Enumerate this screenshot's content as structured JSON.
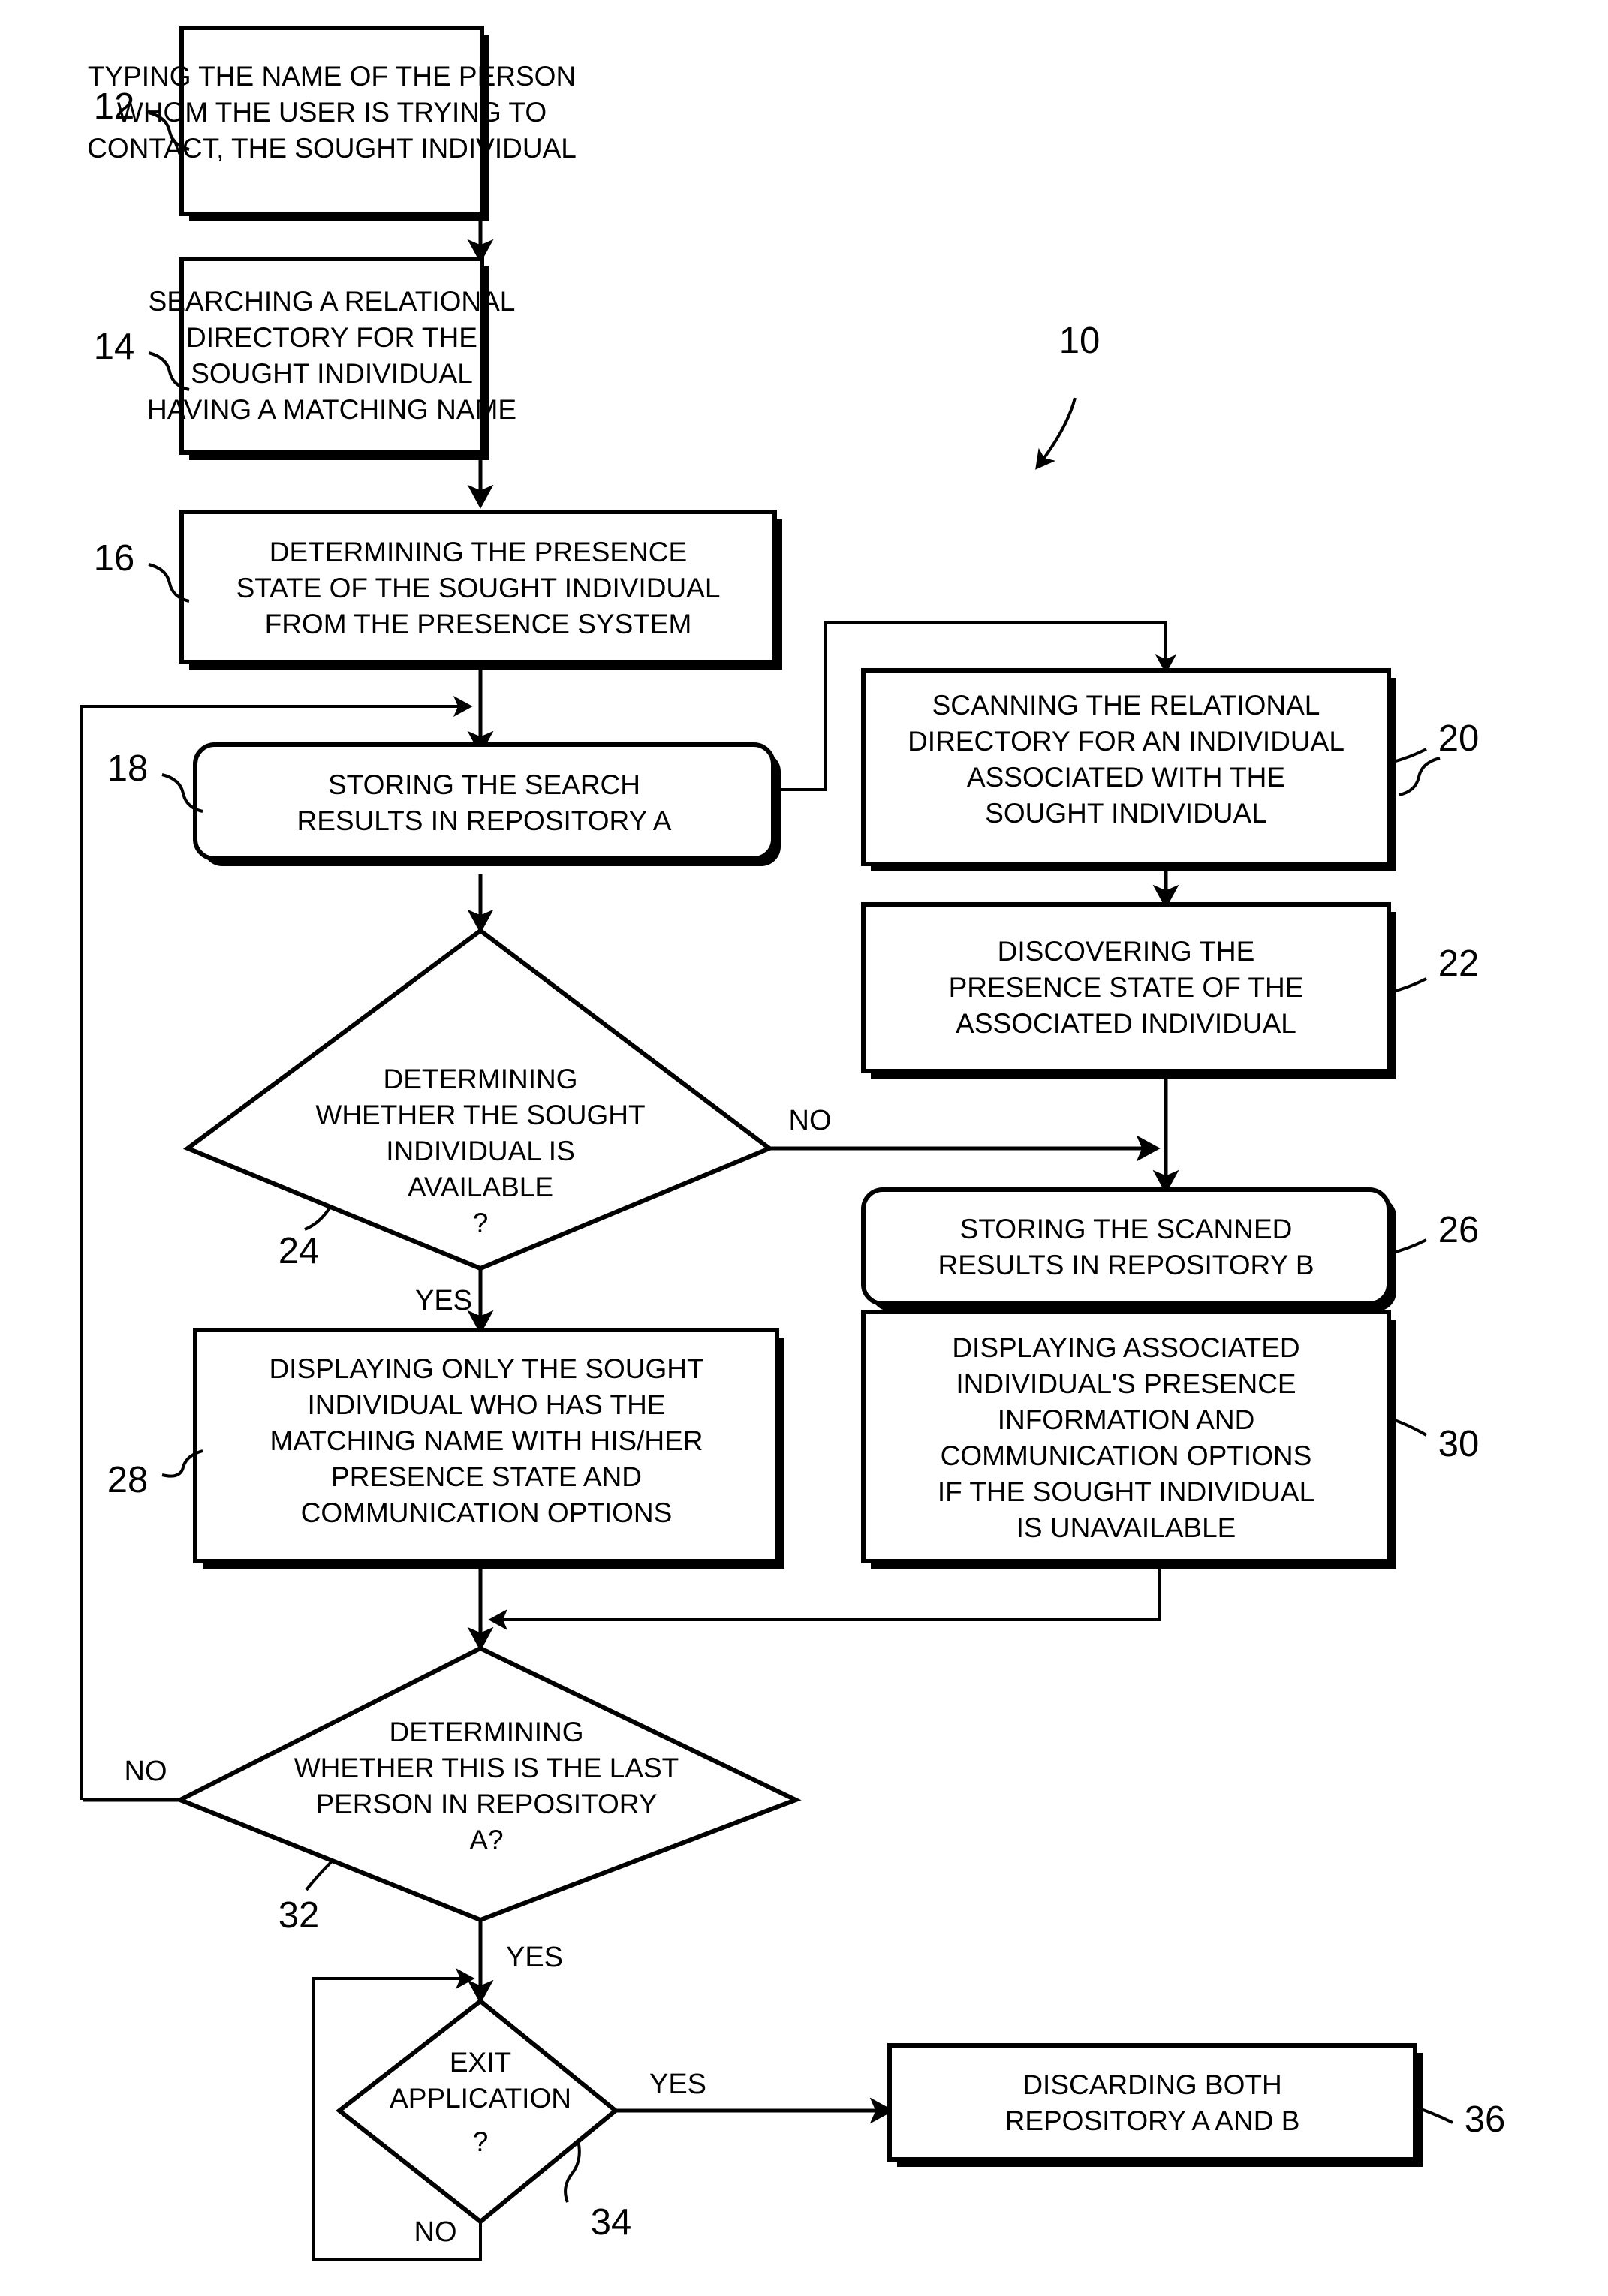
{
  "figure": {
    "reference_numeral": "10",
    "type": "flowchart"
  },
  "nodes": [
    {
      "id": "12",
      "ref": "12",
      "shape": "rect",
      "lines": [
        "TYPING THE NAME OF THE PERSON",
        "WHOM THE USER IS TRYING TO",
        "CONTACT, THE SOUGHT INDIVIDUAL"
      ]
    },
    {
      "id": "14",
      "ref": "14",
      "shape": "rect",
      "lines": [
        "SEARCHING A RELATIONAL",
        "DIRECTORY FOR THE",
        "SOUGHT INDIVIDUAL",
        "HAVING A MATCHING NAME"
      ]
    },
    {
      "id": "16",
      "ref": "16",
      "shape": "rect",
      "lines": [
        "DETERMINING THE PRESENCE",
        "STATE OF THE SOUGHT INDIVIDUAL",
        "FROM THE PRESENCE SYSTEM"
      ]
    },
    {
      "id": "18",
      "ref": "18",
      "shape": "rounded-rect",
      "lines": [
        "STORING THE SEARCH",
        "RESULTS IN REPOSITORY A"
      ]
    },
    {
      "id": "20",
      "ref": "20",
      "shape": "rect",
      "lines": [
        "SCANNING THE RELATIONAL",
        "DIRECTORY FOR AN INDIVIDUAL",
        "ASSOCIATED WITH THE",
        "SOUGHT INDIVIDUAL"
      ]
    },
    {
      "id": "22",
      "ref": "22",
      "shape": "rect",
      "lines": [
        "DISCOVERING THE",
        "PRESENCE STATE OF THE",
        "ASSOCIATED INDIVIDUAL"
      ]
    },
    {
      "id": "24",
      "ref": "24",
      "shape": "diamond",
      "lines": [
        "DETERMINING",
        "WHETHER THE SOUGHT",
        "INDIVIDUAL IS",
        "AVAILABLE",
        "?"
      ]
    },
    {
      "id": "26",
      "ref": "26",
      "shape": "rounded-rect",
      "lines": [
        "STORING THE SCANNED",
        "RESULTS IN REPOSITORY B"
      ]
    },
    {
      "id": "28",
      "ref": "28",
      "shape": "rect",
      "lines": [
        "DISPLAYING ONLY THE SOUGHT",
        "INDIVIDUAL WHO HAS THE",
        "MATCHING NAME WITH HIS/HER",
        "PRESENCE STATE AND",
        "COMMUNICATION OPTIONS"
      ]
    },
    {
      "id": "30",
      "ref": "30",
      "shape": "rect",
      "lines": [
        "DISPLAYING ASSOCIATED",
        "INDIVIDUAL'S PRESENCE",
        "INFORMATION AND",
        "COMMUNICATION OPTIONS",
        "IF THE SOUGHT INDIVIDUAL",
        "IS UNAVAILABLE"
      ]
    },
    {
      "id": "32",
      "ref": "32",
      "shape": "diamond",
      "lines": [
        "DETERMINING",
        "WHETHER THIS IS THE LAST",
        "PERSON IN REPOSITORY",
        "A?"
      ]
    },
    {
      "id": "34",
      "ref": "34",
      "shape": "diamond",
      "lines": [
        "EXIT",
        "APPLICATION",
        "?"
      ]
    },
    {
      "id": "36",
      "ref": "36",
      "shape": "rect",
      "lines": [
        "DISCARDING BOTH",
        "REPOSITORY A AND B"
      ]
    }
  ],
  "edge_labels": {
    "decision24_no": "NO",
    "decision24_yes": "YES",
    "decision32_no": "NO",
    "decision32_yes": "YES",
    "decision34_yes": "YES",
    "decision34_no": "NO"
  },
  "colors": {
    "stroke": "#000000",
    "fill": "#ffffff",
    "background": "#ffffff"
  }
}
